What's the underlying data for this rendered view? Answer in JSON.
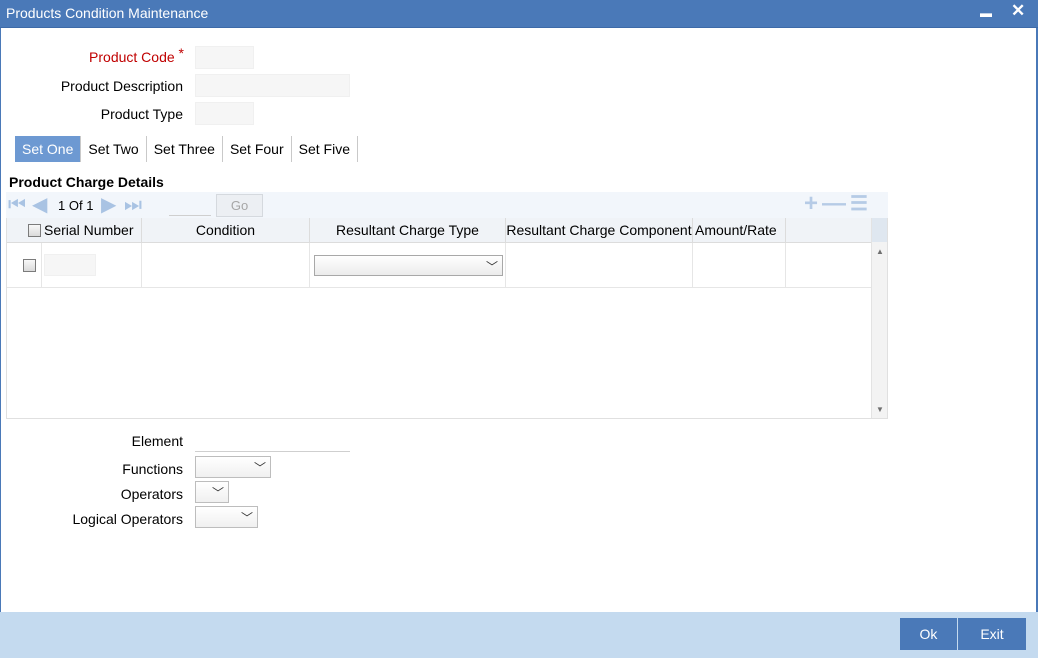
{
  "window": {
    "title": "Products Condition Maintenance",
    "minimize_glyph": "▬",
    "close_glyph": "✕"
  },
  "form": {
    "product_code_label": "Product Code",
    "required_marker": "*",
    "product_description_label": "Product Description",
    "product_type_label": "Product Type"
  },
  "tabs": [
    "Set One",
    "Set Two",
    "Set Three",
    "Set Four",
    "Set Five"
  ],
  "charge_details": {
    "title": "Product Charge Details",
    "pager": {
      "current": "1",
      "of_label": "Of",
      "total": "1",
      "go_label": "Go"
    },
    "columns": [
      "Serial Number",
      "Condition",
      "Resultant Charge Type",
      "Resultant Charge Component",
      "Amount/Rate"
    ]
  },
  "builder": {
    "element_label": "Element",
    "functions_label": "Functions",
    "operators_label": "Operators",
    "logical_operators_label": "Logical Operators"
  },
  "footer": {
    "ok_label": "Ok",
    "exit_label": "Exit"
  },
  "colors": {
    "titlebar": "#4a79b8",
    "active_tab": "#6d99d2",
    "footer": "#c4daef",
    "required": "#c00000"
  }
}
